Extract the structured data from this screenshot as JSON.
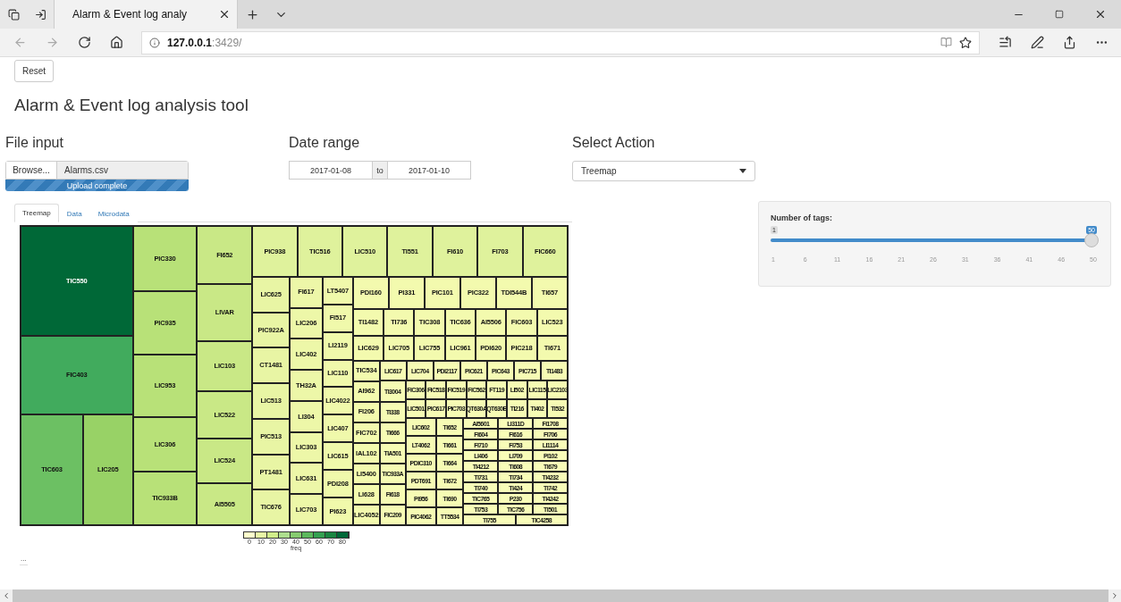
{
  "browser": {
    "tab_title": "Alarm & Event log analy",
    "url_host": "127.0.0.1",
    "url_rest": ":3429/"
  },
  "reset_button": "Reset",
  "title": "Alarm & Event log analysis tool",
  "file_input": {
    "heading": "File input",
    "button": "Browse...",
    "filename": "Alarms.csv",
    "progress": {
      "label": "Upload complete",
      "level": 1
    }
  },
  "date_range": {
    "heading": "Date range",
    "start": "2017-01-08",
    "separator": "to",
    "end": "2017-01-10"
  },
  "select_action": {
    "heading": "Select Action",
    "value": "Treemap"
  },
  "tabs": [
    {
      "label": "Treemap",
      "selected": true
    },
    {
      "label": "Data",
      "selected": false
    },
    {
      "label": "Microdata",
      "selected": false
    }
  ],
  "treemap": {
    "kind": "row",
    "children": [
      {
        "kind": "col",
        "children": [
          {
            "label": "TIC550",
            "color": "#006837"
          },
          {
            "label": "FIC403",
            "color": "#41ab5d"
          },
          {
            "kind": "row",
            "children": [
              {
                "label": "TIC603",
                "color": "#6cc063"
              },
              {
                "label": "LIC205",
                "color": "#98d266"
              }
            ]
          }
        ]
      },
      {
        "kind": "col",
        "color": "#b8e178",
        "children": [
          {
            "label": "PIC330"
          },
          {
            "label": "PIC935"
          },
          {
            "label": "LIC953"
          },
          {
            "label": "LIC306"
          },
          {
            "label": "TIC933B"
          }
        ]
      },
      {
        "kind": "col",
        "color": "#c9e886",
        "children": [
          {
            "label": "FI652"
          },
          {
            "label": "LIVAR"
          },
          {
            "label": "LIC103"
          },
          {
            "label": "LIC522"
          },
          {
            "label": "LIC524"
          },
          {
            "label": "AI5505"
          }
        ]
      },
      {
        "kind": "col",
        "children": [
          {
            "kind": "row",
            "color": "#dff29c",
            "children": [
              {
                "label": "PIC938"
              },
              {
                "label": "TIC516"
              },
              {
                "label": "LIC510"
              },
              {
                "label": "TI551"
              },
              {
                "label": "FI610"
              },
              {
                "label": "FI703"
              },
              {
                "label": "FIC660"
              }
            ]
          },
          {
            "kind": "row",
            "children": [
              {
                "kind": "col",
                "color": "#e8f5a4",
                "children": [
                  {
                    "label": "LIC625"
                  },
                  {
                    "label": "PIC922A"
                  },
                  {
                    "label": "CT1481"
                  },
                  {
                    "label": "LIC513"
                  },
                  {
                    "label": "PIC513"
                  },
                  {
                    "label": "PT1481"
                  },
                  {
                    "label": "TIC676"
                  }
                ]
              },
              {
                "kind": "col",
                "color": "#edf7a8",
                "children": [
                  {
                    "label": "FI617"
                  },
                  {
                    "label": "LIC206"
                  },
                  {
                    "label": "LIC402"
                  },
                  {
                    "label": "TH32A"
                  },
                  {
                    "label": "LI304"
                  },
                  {
                    "label": "LIC303"
                  },
                  {
                    "label": "LIC631"
                  },
                  {
                    "label": "LIC703"
                  }
                ]
              },
              {
                "kind": "col",
                "color": "#f0f9ab",
                "children": [
                  {
                    "label": "LT5407"
                  },
                  {
                    "label": "FI517"
                  },
                  {
                    "label": "LI2119"
                  },
                  {
                    "label": "LIC110"
                  },
                  {
                    "label": "LIC4022"
                  },
                  {
                    "label": "LIC407"
                  },
                  {
                    "label": "LIC615"
                  },
                  {
                    "label": "PDI208"
                  },
                  {
                    "label": "PI623"
                  }
                ]
              },
              {
                "kind": "col",
                "color": "#f3faae",
                "children": [
                  {
                    "kind": "row",
                    "children": [
                      {
                        "label": "PDI160"
                      },
                      {
                        "label": "PI331"
                      },
                      {
                        "label": "PIC101"
                      },
                      {
                        "label": "PIC322"
                      },
                      {
                        "label": "TDI544B"
                      },
                      {
                        "label": "TI657"
                      }
                    ]
                  },
                  {
                    "kind": "row",
                    "children": [
                      {
                        "label": "TI1482"
                      },
                      {
                        "label": "TI736"
                      },
                      {
                        "label": "TIC308"
                      },
                      {
                        "label": "TIC636"
                      },
                      {
                        "label": "AI5506"
                      },
                      {
                        "label": "FIC603"
                      },
                      {
                        "label": "LIC523"
                      }
                    ]
                  },
                  {
                    "kind": "row",
                    "children": [
                      {
                        "label": "LIC629"
                      },
                      {
                        "label": "LIC705"
                      },
                      {
                        "label": "LIC755"
                      },
                      {
                        "label": "LIC961"
                      },
                      {
                        "label": "PDI620"
                      },
                      {
                        "label": "PIC218"
                      },
                      {
                        "label": "TI671"
                      }
                    ]
                  },
                  {
                    "kind": "row",
                    "children": [
                      {
                        "kind": "col",
                        "children": [
                          {
                            "label": "TIC534"
                          },
                          {
                            "label": "AI962"
                          },
                          {
                            "label": "FI206"
                          },
                          {
                            "label": "FIC702"
                          },
                          {
                            "label": "IAL102"
                          },
                          {
                            "label": "LI5400"
                          },
                          {
                            "label": "LI628"
                          },
                          {
                            "label": "LIC4052"
                          }
                        ]
                      },
                      {
                        "kind": "col",
                        "color": "#f6fbb4",
                        "children": [
                          {
                            "kind": "row",
                            "children": [
                              {
                                "label": "LIC617"
                              },
                              {
                                "label": "LIC704"
                              },
                              {
                                "label": "PDI2117"
                              },
                              {
                                "label": "PIC621"
                              },
                              {
                                "label": "PIC643"
                              },
                              {
                                "label": "PIC715"
                              },
                              {
                                "label": "TI1483"
                              }
                            ]
                          },
                          {
                            "kind": "row",
                            "children": [
                              {
                                "kind": "col",
                                "children": [
                                  {
                                    "label": "TI3004"
                                  },
                                  {
                                    "label": "TI338"
                                  },
                                  {
                                    "label": "TI666"
                                  },
                                  {
                                    "label": "TIA501"
                                  },
                                  {
                                    "label": "TIC933A"
                                  },
                                  {
                                    "label": "FI618"
                                  },
                                  {
                                    "label": "FIC209"
                                  }
                                ]
                              },
                              {
                                "kind": "col",
                                "children": [
                                  {
                                    "kind": "row",
                                    "children": [
                                      {
                                        "label": "FIC306"
                                      },
                                      {
                                        "label": "FIC518"
                                      },
                                      {
                                        "label": "FIC519"
                                      },
                                      {
                                        "label": "FIC562"
                                      },
                                      {
                                        "label": "FT119"
                                      },
                                      {
                                        "label": "LI502"
                                      },
                                      {
                                        "label": "LIC115"
                                      },
                                      {
                                        "label": "LIC2103"
                                      }
                                    ]
                                  },
                                  {
                                    "kind": "row",
                                    "children": [
                                      {
                                        "label": "LIC501"
                                      },
                                      {
                                        "label": "PIC617"
                                      },
                                      {
                                        "label": "PIC703"
                                      },
                                      {
                                        "label": "QT630A"
                                      },
                                      {
                                        "label": "QT630B"
                                      },
                                      {
                                        "label": "TI216"
                                      },
                                      {
                                        "label": "TI402"
                                      },
                                      {
                                        "label": "TI532"
                                      }
                                    ]
                                  },
                                  {
                                    "kind": "row",
                                    "children": [
                                      {
                                        "kind": "col",
                                        "children": [
                                          {
                                            "label": "LIC602"
                                          },
                                          {
                                            "label": "LT4062"
                                          },
                                          {
                                            "label": "PDIC310"
                                          },
                                          {
                                            "label": "PDT691"
                                          },
                                          {
                                            "label": "PI956"
                                          },
                                          {
                                            "label": "PIC4062"
                                          }
                                        ]
                                      },
                                      {
                                        "kind": "col",
                                        "children": [
                                          {
                                            "label": "TI652"
                                          },
                                          {
                                            "label": "TI661"
                                          },
                                          {
                                            "label": "TI664"
                                          },
                                          {
                                            "label": "TI672"
                                          },
                                          {
                                            "label": "TI690"
                                          },
                                          {
                                            "label": "TT5534"
                                          }
                                        ]
                                      },
                                      {
                                        "kind": "col",
                                        "color": "#f8fcb8",
                                        "children": [
                                          {
                                            "kind": "row",
                                            "children": [
                                              {
                                                "label": "AI5601"
                                              },
                                              {
                                                "label": "LI311D"
                                              },
                                              {
                                                "label": "FI1708"
                                              }
                                            ]
                                          },
                                          {
                                            "kind": "row",
                                            "children": [
                                              {
                                                "label": "FI604"
                                              },
                                              {
                                                "label": "FI616"
                                              },
                                              {
                                                "label": "FI706"
                                              }
                                            ]
                                          },
                                          {
                                            "kind": "row",
                                            "children": [
                                              {
                                                "label": "FI710"
                                              },
                                              {
                                                "label": "FI753"
                                              },
                                              {
                                                "label": "LI1114"
                                              }
                                            ]
                                          },
                                          {
                                            "kind": "row",
                                            "children": [
                                              {
                                                "label": "LI406"
                                              },
                                              {
                                                "label": "LI709"
                                              },
                                              {
                                                "label": "PI102"
                                              }
                                            ]
                                          },
                                          {
                                            "kind": "row",
                                            "children": [
                                              {
                                                "label": "TI4212"
                                              },
                                              {
                                                "label": "TI608"
                                              },
                                              {
                                                "label": "TI679"
                                              }
                                            ]
                                          },
                                          {
                                            "kind": "row",
                                            "children": [
                                              {
                                                "label": "TI731"
                                              },
                                              {
                                                "label": "TI734"
                                              },
                                              {
                                                "label": "TI4232"
                                              }
                                            ]
                                          },
                                          {
                                            "kind": "row",
                                            "children": [
                                              {
                                                "label": "TI740"
                                              },
                                              {
                                                "label": "TI424"
                                              },
                                              {
                                                "label": "TI742"
                                              }
                                            ]
                                          },
                                          {
                                            "kind": "row",
                                            "children": [
                                              {
                                                "label": "TIC765"
                                              },
                                              {
                                                "label": "P230"
                                              },
                                              {
                                                "label": "TI4242"
                                              }
                                            ]
                                          },
                                          {
                                            "kind": "row",
                                            "children": [
                                              {
                                                "label": "TI753"
                                              },
                                              {
                                                "label": "TIC756"
                                              },
                                              {
                                                "label": "TI501"
                                              }
                                            ]
                                          },
                                          {
                                            "kind": "row",
                                            "children": [
                                              {
                                                "label": "TI755"
                                              },
                                              {
                                                "label": "TIC4258"
                                              }
                                            ]
                                          }
                                        ]
                                      }
                                    ]
                                  }
                                ]
                              }
                            ]
                          }
                        ]
                      }
                    ]
                  }
                ]
              }
            ]
          }
        ]
      }
    ]
  },
  "legend": {
    "items": [
      {
        "label": "0",
        "color": "#ffffcc"
      },
      {
        "label": "10",
        "color": "#e8f6a6"
      },
      {
        "label": "20",
        "color": "#d0ec8a"
      },
      {
        "label": "30",
        "color": "#addd8e"
      },
      {
        "label": "40",
        "color": "#86cb70"
      },
      {
        "label": "50",
        "color": "#5cb85c"
      },
      {
        "label": "60",
        "color": "#34a050"
      },
      {
        "label": "70",
        "color": "#1a8540"
      },
      {
        "label": "80",
        "color": "#006837"
      }
    ],
    "title": "freq"
  },
  "footer_text": "...",
  "slider": {
    "label": "Number of tags:",
    "min": "1",
    "value": "50",
    "level": 1,
    "ticks": [
      "1",
      "6",
      "11",
      "16",
      "21",
      "26",
      "31",
      "36",
      "41",
      "46",
      "50"
    ]
  }
}
